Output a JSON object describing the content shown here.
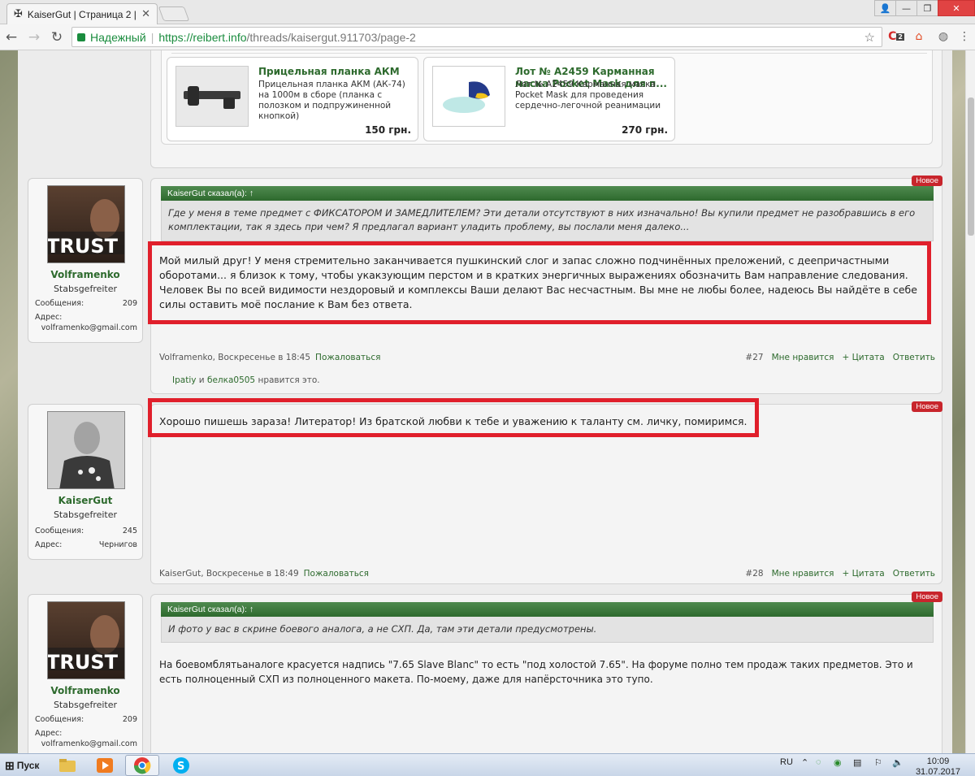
{
  "browser": {
    "tab_title": "KaiserGut | Страница 2 |",
    "secure_label": "Надежный",
    "url_host": "https://reibert.info",
    "url_path": "/threads/kaisergut.911703/page-2",
    "ext_badge": "2"
  },
  "products": [
    {
      "title": "Прицельная планка АКМ",
      "desc": "Прицельная планка АКМ (АК-74) на 1000м в сборе (планка с полозком и подпружиненной кнопкой)",
      "price": "150 грн."
    },
    {
      "title": "Лот № A2459 Карманная маска Pocket Mask для п...",
      "desc": "Лот № A2459 Карманная маска Pocket Mask для проведения сердечно-легочной реанимации Карманная маск...",
      "price": "270 грн."
    }
  ],
  "posts": [
    {
      "user": {
        "name": "Volframenko",
        "rank": "Stabsgefreiter",
        "avatar_text": "TRUST MI",
        "messages_label": "Сообщения:",
        "messages": "209",
        "address_label": "Адрес:",
        "address": "volframenko@gmail.com"
      },
      "badge": "Новое",
      "quote_head": "KaiserGut сказал(а): ↑",
      "quote": "Где у меня в теме предмет с ФИКСАТОРОМ И ЗАМЕДЛИТЕЛЕМ? Эти детали отсутствуют в них изначально! Вы купили предмет не разобравшись в его комплектации, так я здесь при чем? Я предлагал вариант уладить проблему, вы послали меня далеко...",
      "text": "Мой милый друг! У меня стремительно заканчивается пушкинский слог и запас сложно подчинённых преложений, с деепричастными оборотами... я близок к тому, чтобы укакзующим перстом и в кратких энергичных выражениях обозначить Вам направление следования. Человек Вы по всей видимости нездоровый и комплексы Ваши делают Вас несчастным. Вы мне не любы более, надеюсь Вы найдёте в себе силы оставить моё послание к Вам без ответа.",
      "author_date": "Volframenko, Воскресенье в 18:45",
      "report": "Пожаловаться",
      "num": "#27",
      "like": "Мне нравится",
      "quote_btn": "+ Цитата",
      "reply": "Ответить",
      "likes_users": "Ipatiy",
      "likes_and": "и",
      "likes_users2": "белка0505",
      "likes_suffix": "нравится это."
    },
    {
      "user": {
        "name": "KaiserGut",
        "rank": "Stabsgefreiter",
        "messages_label": "Сообщения:",
        "messages": "245",
        "address_label": "Адрес:",
        "address": "Чернигов"
      },
      "badge": "Новое",
      "text": "Хорошо пишешь зараза! Литератор! Из братской любви к тебе и уважению к таланту см. личку, помиримся.",
      "author_date": "KaiserGut, Воскресенье в 18:49",
      "report": "Пожаловаться",
      "num": "#28",
      "like": "Мне нравится",
      "quote_btn": "+ Цитата",
      "reply": "Ответить"
    },
    {
      "user": {
        "name": "Volframenko",
        "rank": "Stabsgefreiter",
        "avatar_text": "TRUST MI",
        "messages_label": "Сообщения:",
        "messages": "209",
        "address_label": "Адрес:",
        "address": "volframenko@gmail.com"
      },
      "badge": "Новое",
      "quote_head": "KaiserGut сказал(а): ↑",
      "quote": "И фото у вас в скрине боевого аналога, а не СХП. Да, там эти детали предусмотрены.",
      "text": "На боевомблятьаналоге красуется надпись \"7.65 Slave Blanc\" то есть \"под холостой 7.65\". На форуме полно тем продаж таких предметов. Это и есть полноценный СХП из полноценного макета. По-моему, даже для напёрсточника это тупо."
    }
  ],
  "taskbar": {
    "start": "Пуск",
    "lang": "RU",
    "time": "10:09",
    "date": "31.07.2017"
  }
}
